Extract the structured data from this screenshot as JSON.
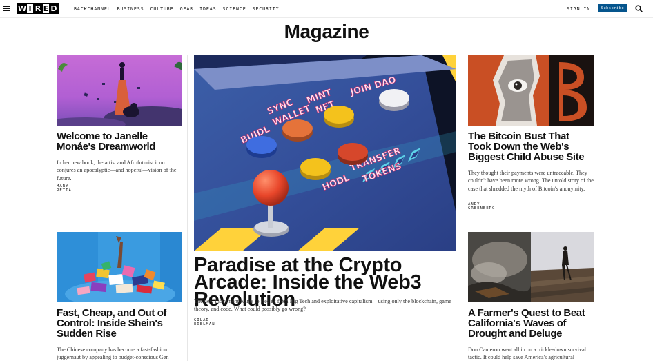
{
  "nav": {
    "logo_letters": [
      "W",
      "I",
      "R",
      "E",
      "D"
    ],
    "links": [
      "Backchannel",
      "Business",
      "Culture",
      "Gear",
      "Ideas",
      "Science",
      "Security"
    ],
    "sign_in": "Sign In",
    "subscribe": "Subscribe",
    "icons": [
      "menu-icon",
      "search-icon"
    ]
  },
  "page": {
    "title": "Magazine"
  },
  "articles": [
    {
      "headline": "Welcome to Janelle Monáe's Dreamworld",
      "dek": "In her new book, the artist and Afrofuturist icon conjures an apocalyptic—and hopeful—vision of the future.",
      "byline": "Mary Retta"
    },
    {
      "headline": "Paradise at the Crypto Arcade: Inside the Web3 Revolution",
      "dek": "The new movement wants to free us from Big Tech and exploitative capitalism—using only the blockchain, game theory, and code. What could possibly go wrong?",
      "byline": "Gilad Edelman",
      "image_labels": [
        "JOIN DAO",
        "MINT NFT",
        "SYNC WALLET",
        "BUIDL",
        "TRANSFER TOKENS",
        "HODL"
      ]
    },
    {
      "headline": "The Bitcoin Bust That Took Down the Web's Biggest Child Abuse Site",
      "dek": "They thought their payments were untraceable. They couldn't have been more wrong. The untold story of the case that shredded the myth of Bitcoin's anonymity.",
      "byline": "Andy Greenberg"
    },
    {
      "headline": "Fast, Cheap, and Out of Control: Inside Shein's Sudden Rise",
      "dek": "The Chinese company has become a fast-fashion juggernaut by appealing to budget-conscious Gen"
    },
    {
      "headline": "A Farmer's Quest to Beat California's Waves of Drought and Deluge",
      "dek": "Don Cameron went all in on a trickle-down survival tactic. It could help save America's agricultural"
    }
  ],
  "colors": {
    "subscribe_bg": "#05558d",
    "text": "#111111"
  }
}
